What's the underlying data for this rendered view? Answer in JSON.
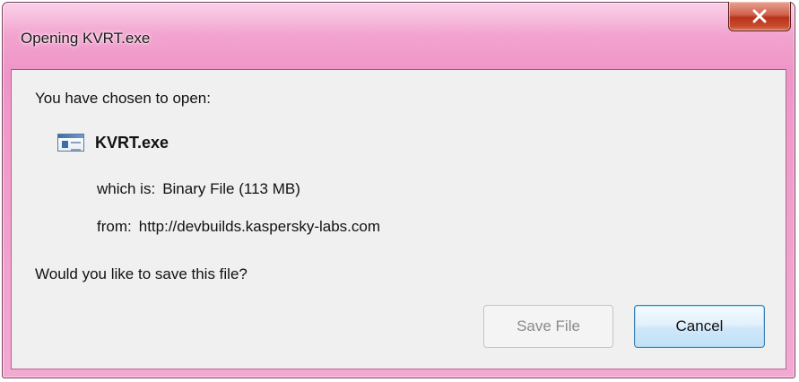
{
  "window": {
    "title": "Opening KVRT.exe",
    "close_label": "x"
  },
  "dialog": {
    "prompt": "You have chosen to open:",
    "file_name": "KVRT.exe",
    "file_icon": "application-window-icon",
    "which_is_label": "which is:",
    "which_is_value": "Binary File (113 MB)",
    "from_label": "from:",
    "from_value": "http://devbuilds.kaspersky-labs.com",
    "question": "Would you like to save this file?"
  },
  "buttons": {
    "save_label": "Save File",
    "save_enabled": false,
    "cancel_label": "Cancel"
  },
  "colors": {
    "title_glass": "#f29fcd",
    "client_bg": "#f0f0f0",
    "close_red": "#c84a2e",
    "focused_button_border": "#3c7fb1"
  }
}
